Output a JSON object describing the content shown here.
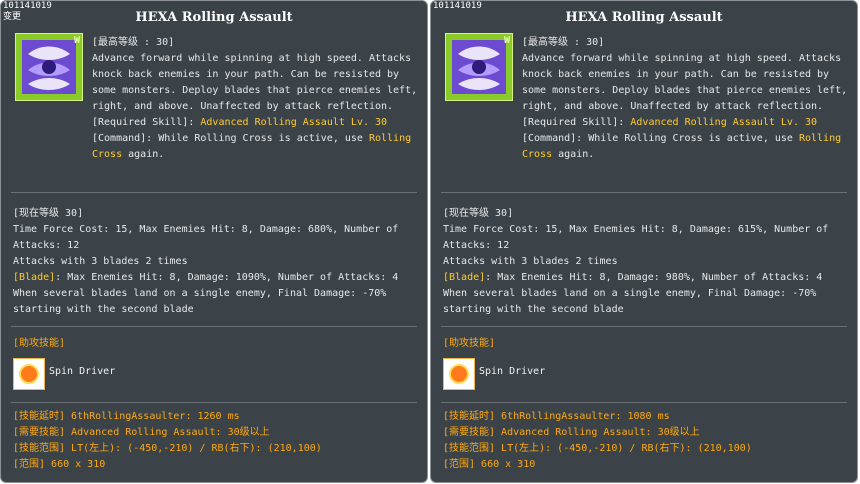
{
  "panels": [
    {
      "skill_id": "101141019",
      "changed_label": "变更",
      "title": "HEXA Rolling Assault",
      "max_level": "[最高等级 : 30]",
      "description": "Advance forward while spinning at high speed. Attacks knock back enemies in your path. Can be resisted by some monsters. Deploy blades that pierce enemies left, right, and above. Unaffected by attack reflection.",
      "required_label": "[Required Skill]:",
      "required_value": "Advanced Rolling Assault Lv. 30",
      "command_label": "[Command]: While Rolling Cross is active, use",
      "command_value": "Rolling Cross",
      "command_end": "again.",
      "current_level": "[现在等级 30]",
      "effect": "Time Force Cost: 15, Max Enemies Hit: 8, Damage: 680%, Number of Attacks: 12",
      "blades": "Attacks with 3 blades 2 times",
      "blade_label": "[Blade]",
      "blade_text": ": Max Enemies Hit: 8, Damage: 1090%, Number of Attacks: 4",
      "final_damage": "When several blades land on a single enemy, Final Damage: -70% starting with the second blade",
      "assist_header": "[助攻技能]",
      "assist_skill": "Spin Driver",
      "delay": "[技能延时] 6thRollingAssaulter: 1260 ms",
      "required": "[需要技能] Advanced Rolling Assault: 30级以上",
      "range": "[技能范围] LT(左上): (-450,-210) / RB(右下): (210,100)",
      "area": "[范围] 660 x 310"
    },
    {
      "skill_id": "101141019",
      "changed_label": "",
      "title": "HEXA Rolling Assault",
      "max_level": "[最高等级 : 30]",
      "description": "Advance forward while spinning at high speed. Attacks knock back enemies in your path. Can be resisted by some monsters. Deploy blades that pierce enemies left, right, and above. Unaffected by attack reflection.",
      "required_label": "[Required Skill]:",
      "required_value": "Advanced Rolling Assault Lv. 30",
      "command_label": "[Command]: While Rolling Cross is active, use",
      "command_value": "Rolling Cross",
      "command_end": "again.",
      "current_level": "[现在等级 30]",
      "effect": "Time Force Cost: 15, Max Enemies Hit: 8, Damage: 615%, Number of Attacks: 12",
      "blades": "Attacks with 3 blades 2 times",
      "blade_label": "[Blade]",
      "blade_text": ": Max Enemies Hit: 8, Damage: 980%, Number of Attacks: 4",
      "final_damage": "When several blades land on a single enemy, Final Damage: -70% starting with the second blade",
      "assist_header": "[助攻技能]",
      "assist_skill": "Spin Driver",
      "delay": "[技能延时] 6thRollingAssaulter: 1080 ms",
      "required": "[需要技能] Advanced Rolling Assault: 30级以上",
      "range": "[技能范围] LT(左上): (-450,-210) / RB(右下): (210,100)",
      "area": "[范围] 660 x 310"
    }
  ],
  "icons": {
    "skill_icon": "hexa-rolling-assault-icon",
    "assist_icon": "spin-driver-icon"
  },
  "colors": {
    "panel_bg": "#3b4248",
    "highlight": "#ffcc33",
    "section_orange": "#ffaa11"
  }
}
